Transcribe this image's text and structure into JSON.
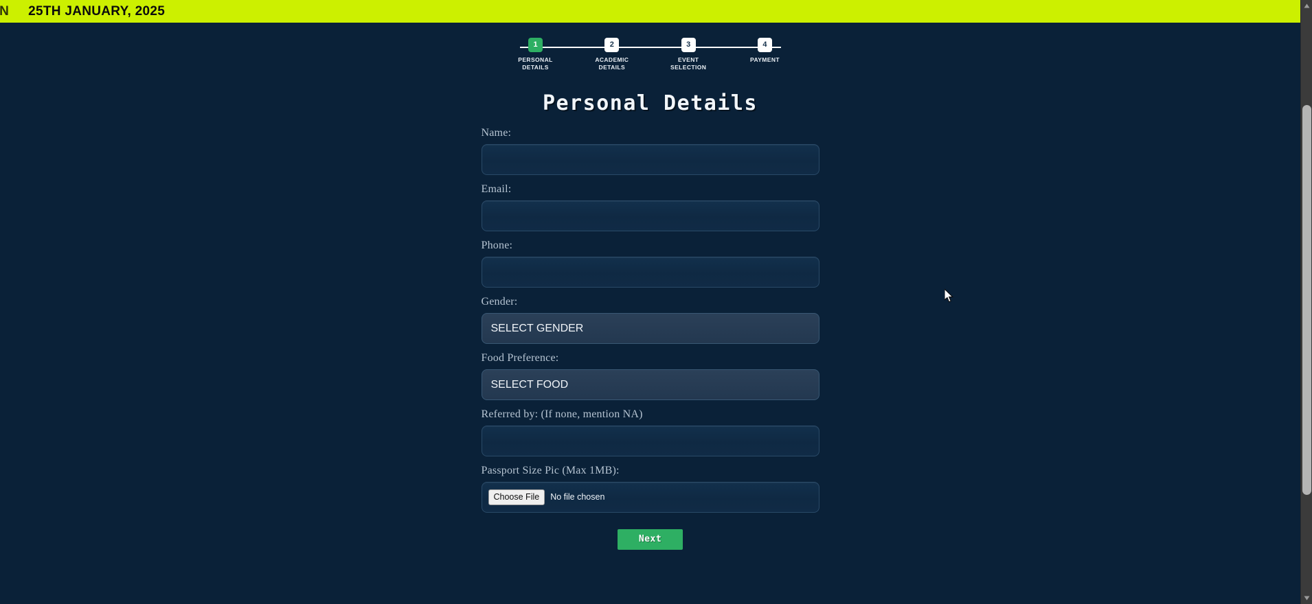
{
  "banner": {
    "clipped_text": "ON",
    "text": "25TH JANUARY, 2025",
    "background_color": "#ccf000",
    "text_color": "#0c0c0c"
  },
  "stepper": {
    "steps": [
      {
        "number": "1",
        "label": "PERSONAL\nDETAILS",
        "state": "active"
      },
      {
        "number": "2",
        "label": "ACADEMIC\nDETAILS",
        "state": "inactive"
      },
      {
        "number": "3",
        "label": "EVENT\nSELECTION",
        "state": "inactive"
      },
      {
        "number": "4",
        "label": "PAYMENT",
        "state": "inactive"
      }
    ],
    "active_color": "#2eaf63",
    "inactive_color": "#ffffff"
  },
  "form": {
    "heading": "Personal Details",
    "fields": {
      "name": {
        "label": "Name:",
        "value": "",
        "placeholder": ""
      },
      "email": {
        "label": "Email:",
        "value": "",
        "placeholder": ""
      },
      "phone": {
        "label": "Phone:",
        "value": "",
        "placeholder": ""
      },
      "gender": {
        "label": "Gender:",
        "selected": "SELECT GENDER",
        "options": [
          "SELECT GENDER"
        ]
      },
      "food": {
        "label": "Food Preference:",
        "selected": "SELECT FOOD",
        "options": [
          "SELECT FOOD"
        ]
      },
      "referred": {
        "label": "Referred by: (If none, mention NA)",
        "value": "",
        "placeholder": ""
      },
      "passport": {
        "label": "Passport Size Pic (Max 1MB):",
        "button_label": "Choose File",
        "status": "No file chosen"
      }
    },
    "submit_label": "Next",
    "submit_color": "#2eaf63"
  },
  "page": {
    "background_color": "#0a2138"
  }
}
